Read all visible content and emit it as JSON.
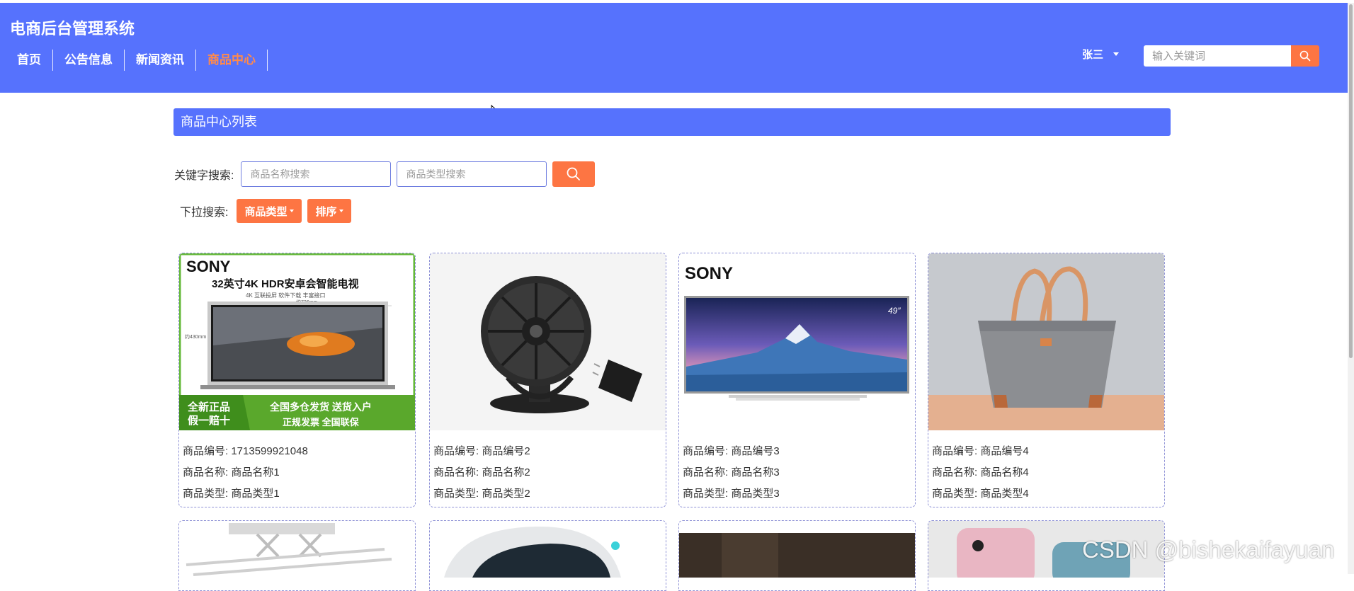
{
  "header": {
    "title": "电商后台管理系统",
    "nav": [
      {
        "label": "首页",
        "active": false
      },
      {
        "label": "公告信息",
        "active": false
      },
      {
        "label": "新闻资讯",
        "active": false
      },
      {
        "label": "商品中心",
        "active": true
      }
    ],
    "user": "张三",
    "search_placeholder": "输入关键词"
  },
  "main": {
    "section_title": "商品中心列表",
    "keyword_label": "关键字搜索:",
    "name_placeholder": "商品名称搜索",
    "type_placeholder": "商品类型搜索",
    "dropdown_label": "下拉搜索:",
    "dropdowns": [
      "商品类型",
      "排序"
    ],
    "products": [
      {
        "no_label": "商品编号:",
        "no": "1713599921048",
        "name_label": "商品名称:",
        "name": "商品名称1",
        "type_label": "商品类型:",
        "type": "商品类型1",
        "image_text": {
          "brand": "SONY",
          "headline": "32英寸4K HDR安卓会智能电视",
          "sub": "4K 互联投屏  软件下载  丰富接口",
          "size": "约726mm",
          "height": "约430mm",
          "badge1": "全新正品",
          "badge2": "假一赔十",
          "banner1": "全国多仓发货  送货入户",
          "banner2": "正规发票   全国联保"
        }
      },
      {
        "no_label": "商品编号:",
        "no": "商品编号2",
        "name_label": "商品名称:",
        "name": "商品名称2",
        "type_label": "商品类型:",
        "type": "商品类型2"
      },
      {
        "no_label": "商品编号:",
        "no": "商品编号3",
        "name_label": "商品名称:",
        "name": "商品名称3",
        "type_label": "商品类型:",
        "type": "商品类型3",
        "image_text": {
          "brand": "SONY",
          "size": "49″"
        }
      },
      {
        "no_label": "商品编号:",
        "no": "商品编号4",
        "name_label": "商品名称:",
        "name": "商品名称4",
        "type_label": "商品类型:",
        "type": "商品类型4"
      }
    ]
  },
  "watermark": "CSDN @bishekaifayuan",
  "colors": {
    "header": "#5672fd",
    "accent": "#fd7543",
    "active_nav": "#ff8a4c"
  }
}
